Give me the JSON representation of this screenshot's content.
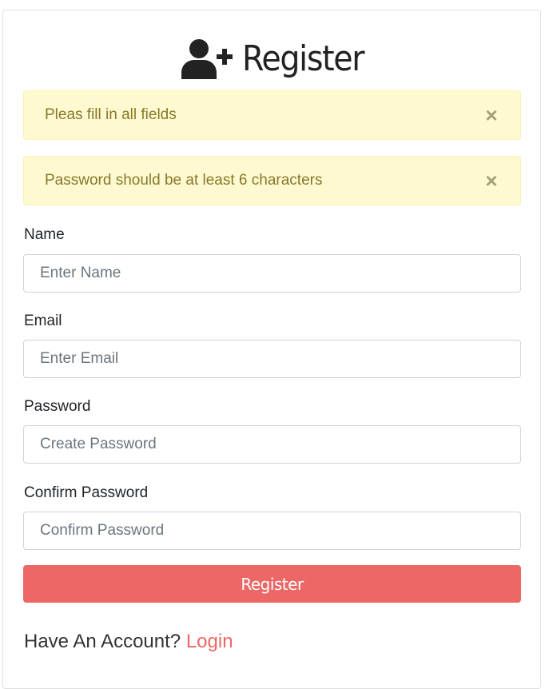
{
  "header": {
    "icon": "user-plus-icon",
    "title": "Register"
  },
  "alerts": [
    {
      "message": "Pleas fill in all fields",
      "close_glyph": "×"
    },
    {
      "message": "Password should be at least 6 characters",
      "close_glyph": "×"
    }
  ],
  "form": {
    "name": {
      "label": "Name",
      "placeholder": "Enter Name",
      "value": ""
    },
    "email": {
      "label": "Email",
      "placeholder": "Enter Email",
      "value": ""
    },
    "password": {
      "label": "Password",
      "placeholder": "Create Password",
      "value": ""
    },
    "confirm_password": {
      "label": "Confirm Password",
      "placeholder": "Confirm Password",
      "value": ""
    },
    "submit_label": "Register"
  },
  "footer": {
    "prompt": "Have An Account?",
    "link_label": "Login"
  },
  "colors": {
    "accent": "#ec6766",
    "alert_bg": "#fff9d2",
    "alert_text": "#877928"
  }
}
